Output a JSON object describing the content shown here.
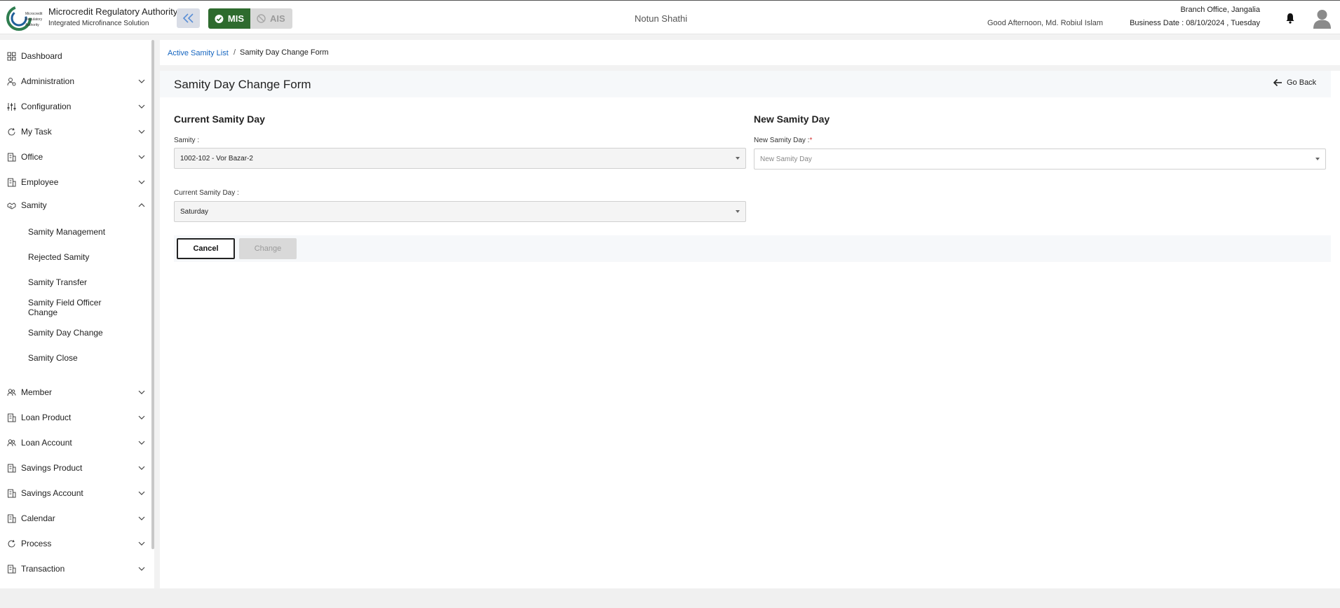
{
  "header": {
    "brand_title": "Microcredit Regulatory Authority",
    "brand_subtitle": "Integrated Microfinance Solution",
    "logo_text": "Microcredit Regulatory Authority",
    "modes": [
      {
        "label": "MIS",
        "active": true,
        "icon": "check-circle-icon"
      },
      {
        "label": "AIS",
        "active": false,
        "icon": "ban-icon"
      }
    ],
    "org_name": "Notun Shathi",
    "greeting": "Good Afternoon, Md. Robiul Islam",
    "branch": "Branch Office, Jangalia",
    "business_date": "Business Date : 08/10/2024 , Tuesday"
  },
  "sidebar": {
    "items": [
      {
        "label": "Dashboard",
        "icon": "grid-icon",
        "expandable": false
      },
      {
        "label": "Administration",
        "icon": "user-gear-icon",
        "expandable": true
      },
      {
        "label": "Configuration",
        "icon": "sliders-icon",
        "expandable": true
      },
      {
        "label": "My Task",
        "icon": "refresh-icon",
        "expandable": true
      },
      {
        "label": "Office",
        "icon": "building-icon",
        "expandable": true
      },
      {
        "label": "Employee",
        "icon": "building-icon",
        "expandable": true
      },
      {
        "label": "Samity",
        "icon": "handshake-icon",
        "expandable": true,
        "expanded": true
      },
      {
        "label": "Member",
        "icon": "users-icon",
        "expandable": true
      },
      {
        "label": "Loan Product",
        "icon": "building-icon",
        "expandable": true
      },
      {
        "label": "Loan Account",
        "icon": "users-icon",
        "expandable": true
      },
      {
        "label": "Savings Product",
        "icon": "building-icon",
        "expandable": true
      },
      {
        "label": "Savings Account",
        "icon": "building-icon",
        "expandable": true
      },
      {
        "label": "Calendar",
        "icon": "building-icon",
        "expandable": true
      },
      {
        "label": "Process",
        "icon": "refresh-icon",
        "expandable": true
      },
      {
        "label": "Transaction",
        "icon": "building-icon",
        "expandable": true
      }
    ],
    "samity_sub": [
      "Samity Management",
      "Rejected Samity",
      "Samity Transfer",
      "Samity Field Officer Change",
      "Samity Day Change",
      "Samity Close"
    ]
  },
  "breadcrumb": {
    "link": "Active Samity List",
    "separator": "/",
    "current": "Samity Day Change Form"
  },
  "page": {
    "title": "Samity Day Change Form",
    "go_back": "Go Back"
  },
  "form": {
    "current_section": "Current Samity Day",
    "new_section": "New Samity Day",
    "samity_label": "Samity :",
    "samity_value": "1002-102 - Vor Bazar-2",
    "current_day_label": "Current Samity Day :",
    "current_day_value": "Saturday",
    "new_day_label": "New Samity Day :",
    "new_day_required": "*",
    "new_day_placeholder": "New Samity Day",
    "cancel": "Cancel",
    "change": "Change"
  },
  "colors": {
    "accent_green": "#2e6b2e",
    "link_blue": "#1565c0",
    "required_red": "#d32f2f"
  }
}
